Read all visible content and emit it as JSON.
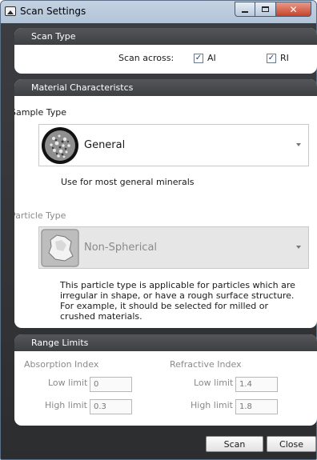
{
  "window": {
    "title": "Scan Settings",
    "icon": "scanner-icon",
    "controls": {
      "minimize": "minimize-icon",
      "maximize": "maximize-icon",
      "close": "close-icon"
    }
  },
  "scan_type": {
    "header": "Scan Type",
    "scan_across_label": "Scan across:",
    "options": [
      {
        "label": "AI",
        "checked": true
      },
      {
        "label": "RI",
        "checked": true
      }
    ]
  },
  "material": {
    "header": "Material Characteristcs",
    "sample_type": {
      "label": "Sample Type",
      "selected": "General",
      "thumbnail": "granular-sample-icon",
      "description": "Use for most general minerals"
    },
    "particle_type": {
      "label": "Particle Type",
      "selected": "Non-Spherical",
      "thumbnail": "irregular-particle-icon",
      "description": "This particle type is applicable for particles which are irregular in shape, or have a rough surface structure. For example, it should be selected for milled or crushed materials."
    }
  },
  "range_limits": {
    "header": "Range Limits",
    "absorption": {
      "title": "Absorption Index",
      "low_label": "Low limit",
      "low_value": "0",
      "high_label": "High limit",
      "high_value": "0.3"
    },
    "refractive": {
      "title": "Refractive Index",
      "low_label": "Low limit",
      "low_value": "1.4",
      "high_label": "High limit",
      "high_value": "1.8"
    }
  },
  "footer": {
    "scan_label": "Scan",
    "close_label": "Close"
  },
  "colors": {
    "panel_header": "#3d3f42",
    "window_body": "#2c2d2f",
    "titlebar": "#b2c4d8",
    "close_button": "#c7432a"
  }
}
